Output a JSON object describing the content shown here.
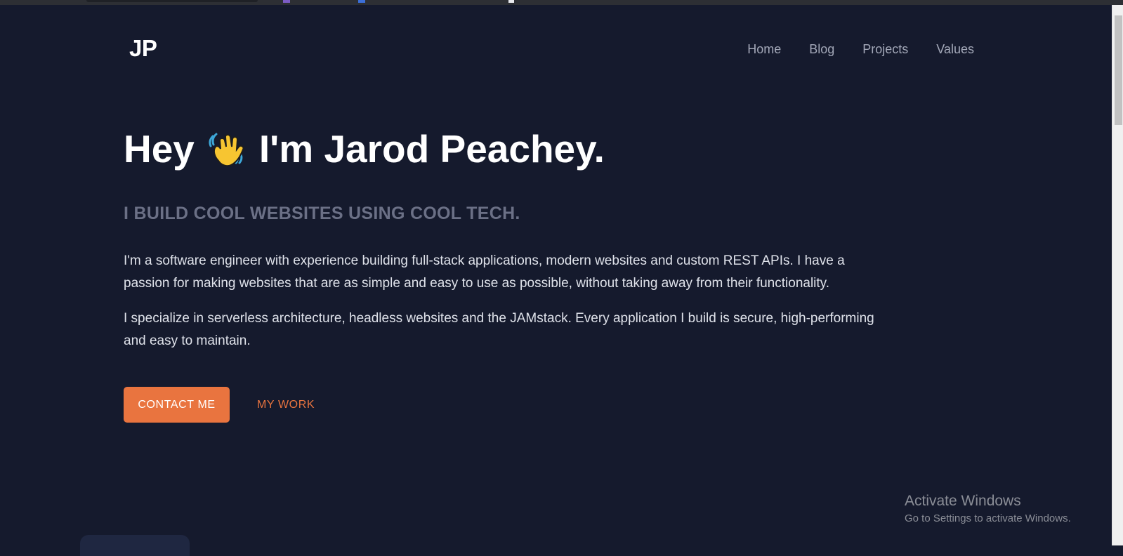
{
  "site": {
    "logo": "JP"
  },
  "nav": {
    "items": [
      {
        "label": "Home"
      },
      {
        "label": "Blog"
      },
      {
        "label": "Projects"
      },
      {
        "label": "Values"
      }
    ]
  },
  "hero": {
    "title_before_emoji": "Hey",
    "emoji_icon": "waving-hand-icon",
    "title_after_emoji": "I'm Jarod Peachey.",
    "subtitle": "I BUILD COOL WEBSITES USING COOL TECH.",
    "paragraphs": [
      "I'm a software engineer with experience building full-stack applications, modern websites and custom REST APIs. I have a passion for making websites that are as simple and easy to use as possible, without taking away from their functionality.",
      "I specialize in serverless architecture, headless websites and the JAMstack. Every application I build is secure, high-performing and easy to maintain."
    ],
    "primary_button": "CONTACT ME",
    "secondary_link": "MY WORK"
  },
  "watermark": {
    "title": "Activate Windows",
    "subtitle": "Go to Settings to activate Windows."
  },
  "colors": {
    "background": "#151a2d",
    "accent": "#e9743f",
    "muted_text": "#6b7086",
    "nav_text": "#a3a8b8"
  }
}
